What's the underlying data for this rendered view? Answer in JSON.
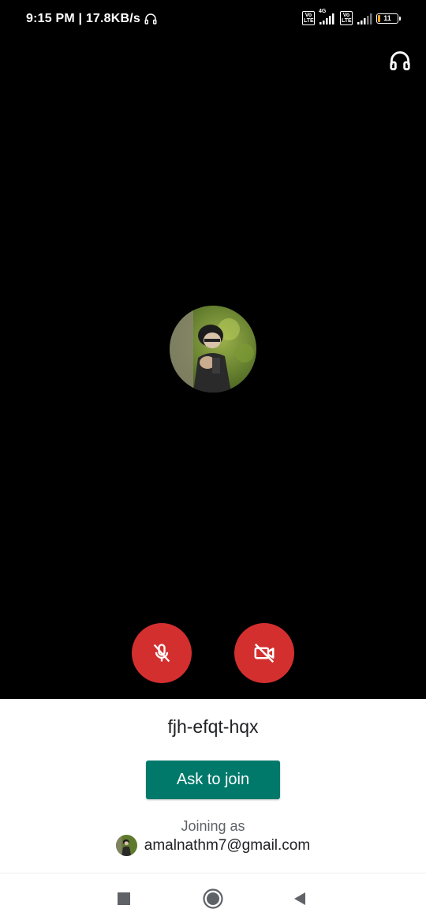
{
  "status_bar": {
    "time_speed": "9:15 PM | 17.8KB/s",
    "volte_label": "Vo LTE",
    "network_label": "4G",
    "battery_level": "11",
    "battery_fraction": 0.11
  },
  "meeting": {
    "code": "fjh-efqt-hqx",
    "join_button_label": "Ask to join",
    "joining_as_label": "Joining as",
    "account_email": "amalnathm7@gmail.com"
  },
  "controls": {
    "mic": "mic-off-icon",
    "camera": "camera-off-icon",
    "audio": "headset-icon"
  },
  "colors": {
    "background": "#000000",
    "control_red": "#d32f2f",
    "join_green": "#00796b",
    "text_primary": "#202124",
    "text_secondary": "#5f6368"
  }
}
